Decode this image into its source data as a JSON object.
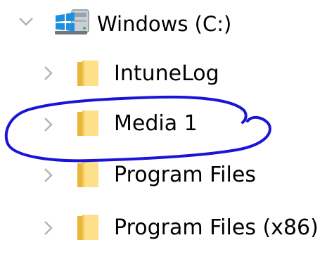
{
  "tree": {
    "root": {
      "label": "Windows (C:)",
      "expanded": true,
      "icon": "windows-drive-icon"
    },
    "children": [
      {
        "label": "IntuneLog",
        "expanded": false,
        "icon": "folder-icon"
      },
      {
        "label": "Media 1",
        "expanded": false,
        "icon": "folder-icon",
        "annotated": true
      },
      {
        "label": "Program Files",
        "expanded": false,
        "icon": "folder-icon"
      },
      {
        "label": "Program Files (x86)",
        "expanded": false,
        "icon": "folder-icon"
      }
    ]
  },
  "annotation": {
    "type": "hand-drawn-loop",
    "color": "#1a14d6",
    "target": "Media 1"
  },
  "colors": {
    "chevron": "#b3b3b3",
    "folder_light": "#ffe08a",
    "folder_dark": "#e8b63a",
    "drive_blue": "#1e90e0",
    "annotation": "#1a14d6"
  }
}
